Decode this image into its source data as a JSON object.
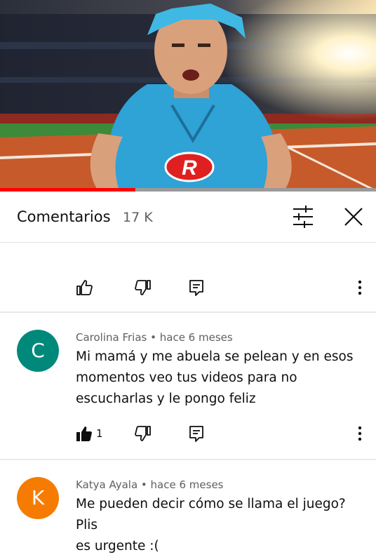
{
  "video": {
    "logo_letter": "R",
    "progress": 0.36,
    "colors": {
      "progress_fill": "#ff0000",
      "shirt": "#2fa2d6",
      "hair": "#3fb8e4",
      "field": "#c75a2a",
      "grass": "#3d8a3a"
    }
  },
  "header": {
    "title": "Comentarios",
    "count": "17 K",
    "filter_icon": "sliders-icon",
    "close_icon": "close-icon"
  },
  "comments": [
    {
      "partial": true,
      "actions": {
        "like_icon": "thumb-up-icon",
        "dislike_icon": "thumb-down-icon",
        "reply_icon": "reply-icon",
        "more_icon": "more-vert-icon"
      }
    },
    {
      "avatar_letter": "C",
      "avatar_color": "#00897b",
      "author": "Carolina Frias",
      "time": "hace 6 meses",
      "meta": "Carolina Frias • hace 6 meses",
      "text_lines": [
        "Mi mamá y me abuela se pelean y en esos",
        "momentos veo tus videos para no",
        "escucharlas y le pongo feliz"
      ],
      "likes": "1",
      "liked": true
    },
    {
      "avatar_letter": "K",
      "avatar_color": "#f57c00",
      "author": "Katya Ayala",
      "time": "hace 6 meses",
      "meta": "Katya Ayala • hace 6 meses",
      "text_lines": [
        "Me pueden decir cómo se llama el juego? Plis",
        "es urgente :("
      ]
    }
  ]
}
